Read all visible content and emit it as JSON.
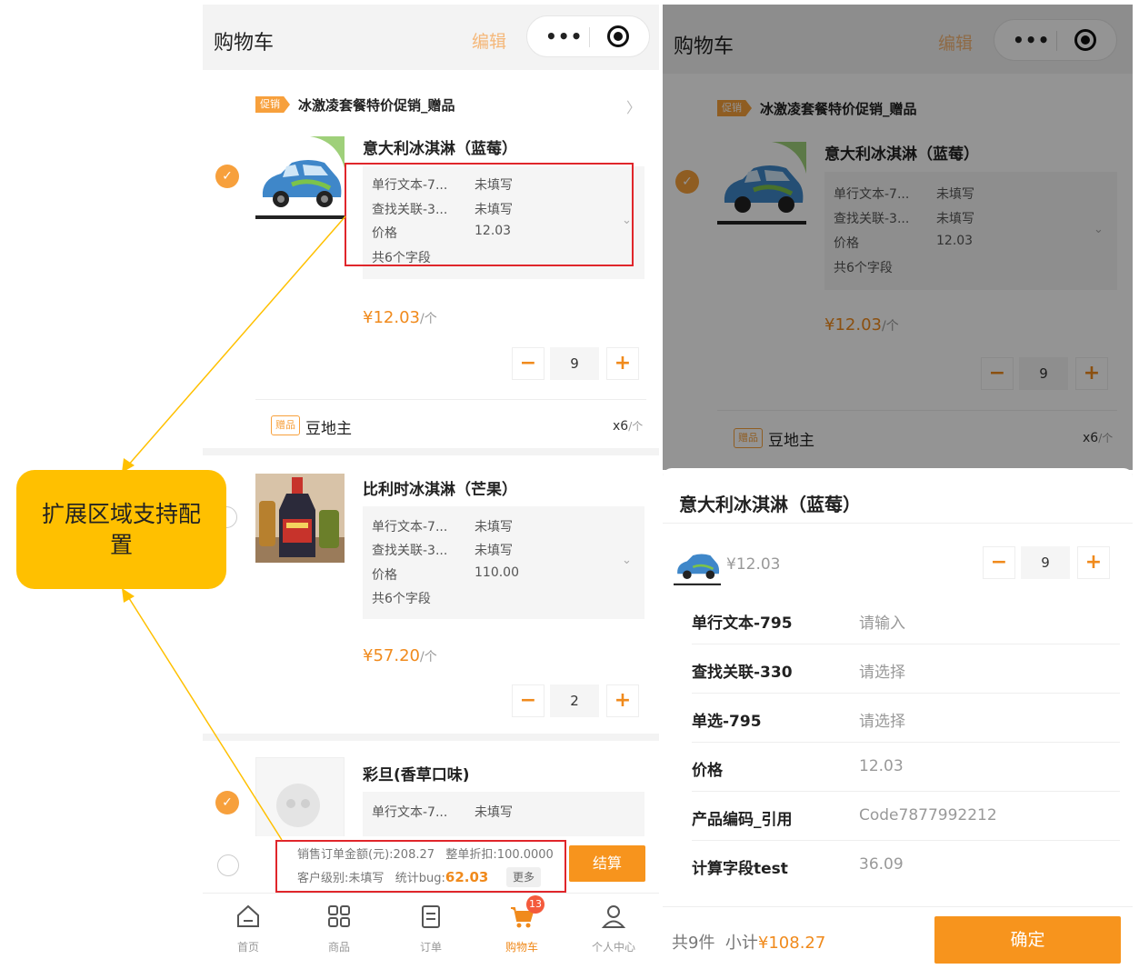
{
  "left": {
    "nav": {
      "title": "购物车",
      "edit": "编辑",
      "dots": "•••"
    },
    "promo": {
      "tag": "促销",
      "text": "冰激凌套餐特价促销_赠品",
      "chevron": "〉"
    },
    "items": [
      {
        "name": "意大利冰淇淋（蓝莓）",
        "checked": true,
        "fields": [
          {
            "label": "单行文本-7...",
            "value": "未填写"
          },
          {
            "label": "查找关联-3...",
            "value": "未填写"
          },
          {
            "label": "价格",
            "value": "12.03"
          },
          {
            "label": "共6个字段",
            "value": ""
          }
        ],
        "price": "¥12.03",
        "unit": "/个",
        "qty": "9"
      },
      {
        "name": "比利时冰淇淋（芒果）",
        "checked": false,
        "fields": [
          {
            "label": "单行文本-7...",
            "value": "未填写"
          },
          {
            "label": "查找关联-3...",
            "value": "未填写"
          },
          {
            "label": "价格",
            "value": "110.00"
          },
          {
            "label": "共6个字段",
            "value": ""
          }
        ],
        "price": "¥57.20",
        "unit": "/个",
        "qty": "2"
      },
      {
        "name": "彩旦(香草口味)",
        "checked": true,
        "fields": [
          {
            "label": "单行文本-7...",
            "value": "未填写"
          }
        ]
      }
    ],
    "gift": {
      "tag": "赠品",
      "name": "豆地主",
      "qty": "x6",
      "unit": "/个"
    },
    "footer": {
      "order_amount": "销售订单金额(元):208.27",
      "discount": "整单折扣:100.0000",
      "customer_level": "客户级别:未填写",
      "stat_label": "统计bug:",
      "stat_value": "62.03",
      "more": "更多",
      "checkout": "结算"
    },
    "tabs": [
      {
        "label": "首页",
        "icon": "home-icon"
      },
      {
        "label": "商品",
        "icon": "grid-icon"
      },
      {
        "label": "订单",
        "icon": "order-icon"
      },
      {
        "label": "购物车",
        "icon": "cart-icon",
        "badge": "13",
        "active": true
      },
      {
        "label": "个人中心",
        "icon": "person-icon"
      }
    ]
  },
  "callout": {
    "text": "扩展区域支持配置"
  },
  "right": {
    "nav": {
      "title": "购物车",
      "edit": "编辑"
    },
    "promo": {
      "tag": "促销",
      "text": "冰激凌套餐特价促销_赠品"
    },
    "item": {
      "name": "意大利冰淇淋（蓝莓）",
      "fields": [
        {
          "label": "单行文本-7...",
          "value": "未填写"
        },
        {
          "label": "查找关联-3...",
          "value": "未填写"
        },
        {
          "label": "价格",
          "value": "12.03"
        },
        {
          "label": "共6个字段",
          "value": ""
        }
      ],
      "price": "¥12.03",
      "unit": "/个",
      "qty": "9"
    },
    "gift": {
      "tag": "赠品",
      "name": "豆地主",
      "qty": "x6",
      "unit": "/个"
    },
    "sheet": {
      "title": "意大利冰淇淋（蓝莓）",
      "price": "¥12.03",
      "qty": "9",
      "rows": [
        {
          "label": "单行文本-795",
          "value": "请输入"
        },
        {
          "label": "查找关联-330",
          "value": "请选择"
        },
        {
          "label": "单选-795",
          "value": "请选择"
        },
        {
          "label": "价格",
          "value": "12.03"
        },
        {
          "label": "产品编码_引用",
          "value": "Code7877992212"
        },
        {
          "label": "计算字段test",
          "value": "36.09"
        }
      ],
      "count": "共9件",
      "subtotal_label": "小计",
      "subtotal": "¥108.27",
      "confirm": "确定"
    }
  }
}
